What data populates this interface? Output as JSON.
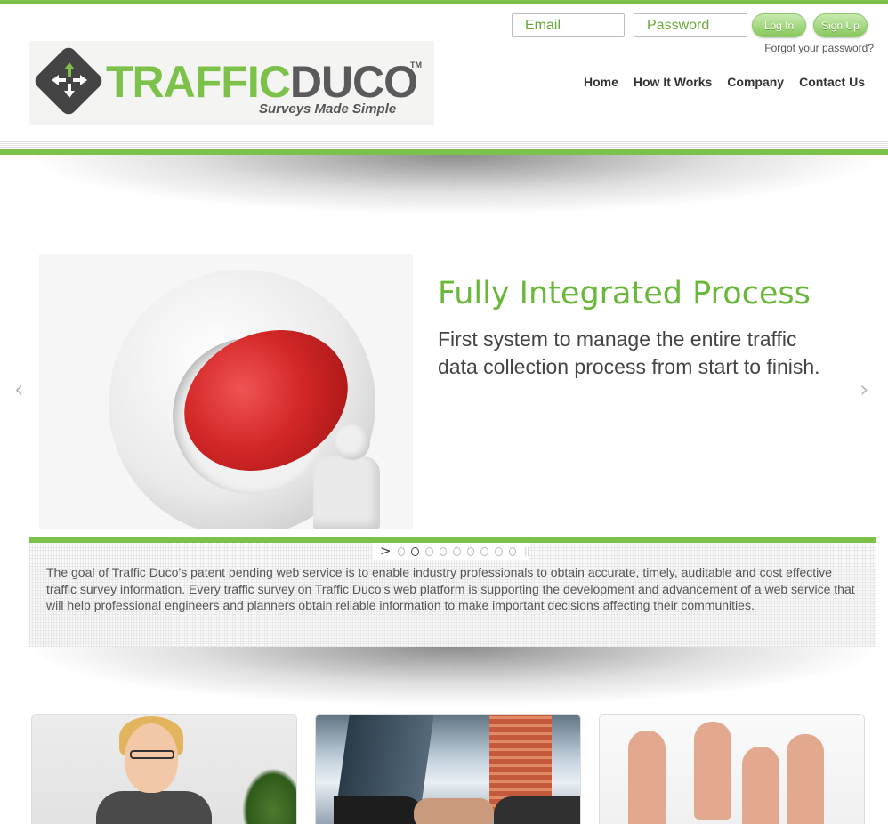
{
  "header": {
    "email_placeholder": "Email",
    "password_placeholder": "Password",
    "login_label": "Log In",
    "signup_label": "Sign Up",
    "forgot_label": "Forgot your password?"
  },
  "logo": {
    "word_green": "TRAFFIC",
    "word_gray": "DUCO",
    "trademark": "TM",
    "tagline": "Surveys Made Simple"
  },
  "nav": {
    "items": [
      "Home",
      "How It Works",
      "Company",
      "Contact Us"
    ]
  },
  "slider": {
    "title": "Fully Integrated Process",
    "text": "First system to manage the entire traffic data collection process from start to finish.",
    "prev_glyph": "‹",
    "next_glyph": "›",
    "play_glyph": ">",
    "pause_glyph": "||",
    "dot_count": 9,
    "active_dot": 1
  },
  "info": {
    "text": "The goal of Traffic Duco’s patent pending web service is to enable industry professionals to obtain accurate, timely, auditable and cost effective traffic survey information. Every traffic survey on Traffic Duco’s web platform is supporting the development and advancement of a web service that will help professional engineers and planners obtain reliable information to make important decisions affecting their communities."
  },
  "colors": {
    "brand_green": "#7cc24a",
    "title_green": "#6ab83a",
    "logo_gray": "#5a5a5a"
  }
}
